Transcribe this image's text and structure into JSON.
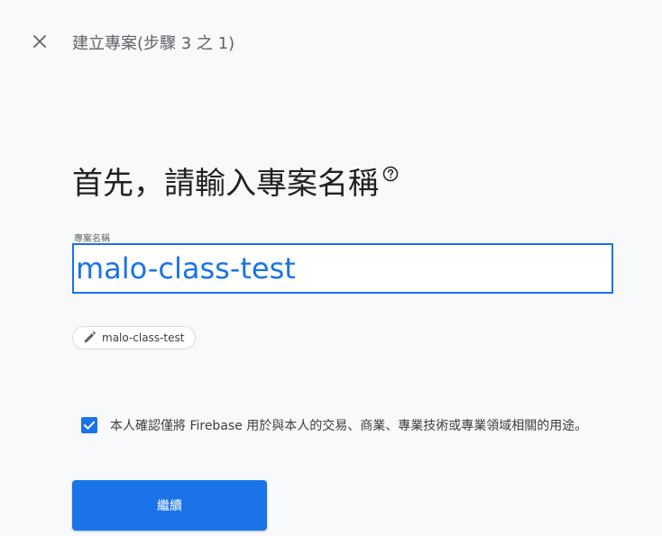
{
  "header": {
    "close_icon": "close-icon",
    "title": "建立專案(步驟 3 之 1)"
  },
  "main": {
    "heading": "首先，請輸入專案名稱",
    "help_icon": "help-circle-icon",
    "project_name_label": "專案名稱",
    "project_name_value": "malo-class-test",
    "project_id_chip": {
      "icon": "pencil-icon",
      "label": "malo-class-test"
    },
    "consent": {
      "checked": true,
      "text": "本人確認僅將 Firebase 用於與本人的交易、商業、專業技術或專業領域相關的用途。"
    },
    "continue_label": "繼續"
  },
  "colors": {
    "accent": "#1a73e8",
    "background": "#f8f9fa",
    "text_primary": "#202124",
    "text_secondary": "#5f6368"
  }
}
